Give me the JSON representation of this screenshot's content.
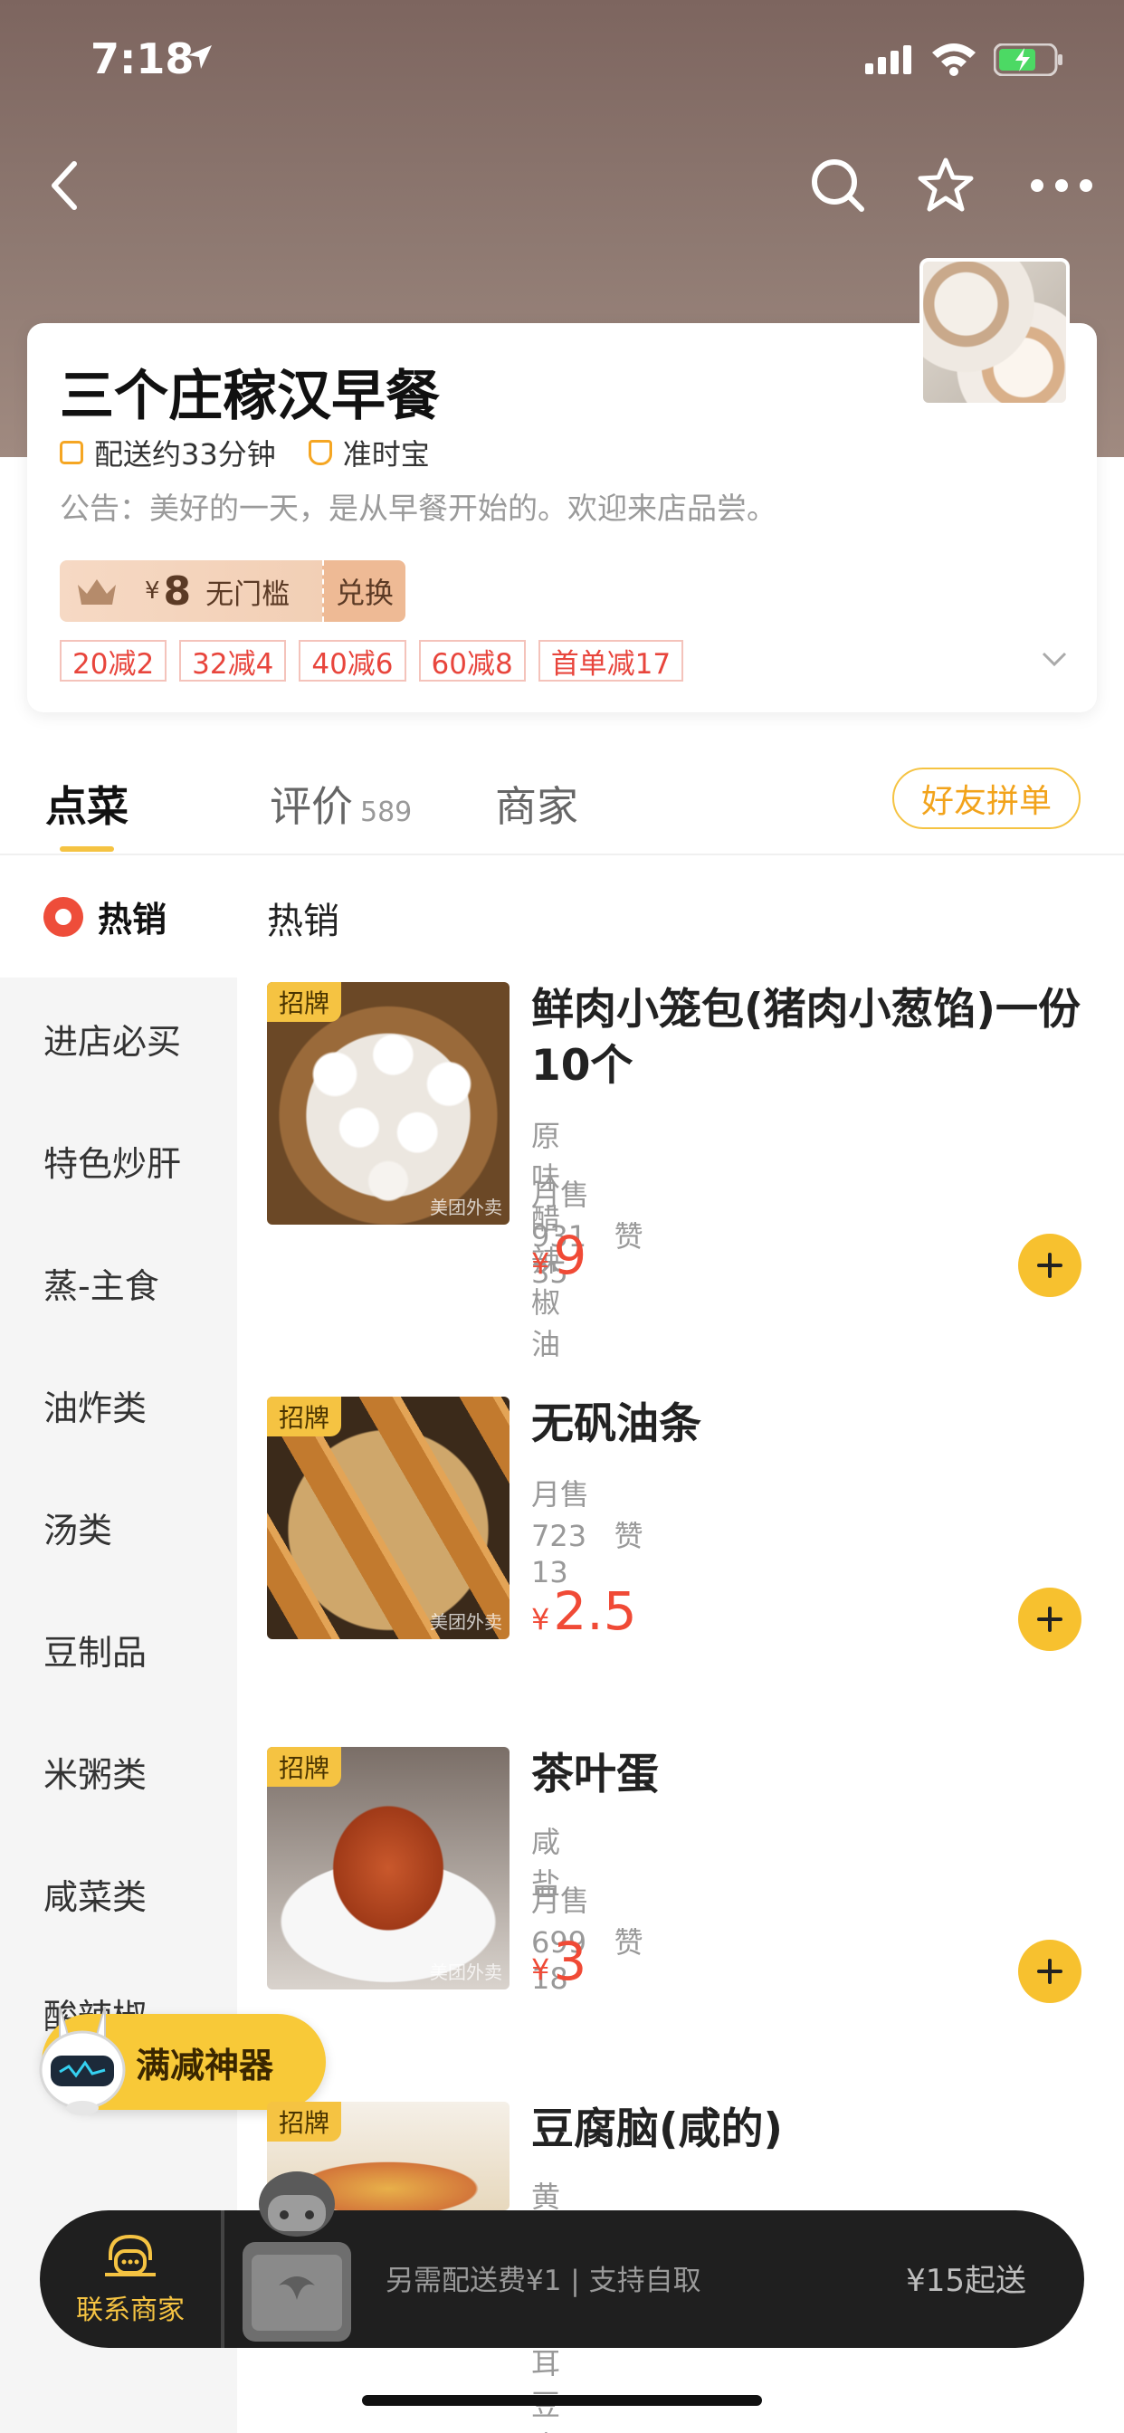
{
  "status_bar": {
    "time": "7:18"
  },
  "nav": {
    "back_icon": "back-icon",
    "search_icon": "search-icon",
    "favorite_icon": "star-icon",
    "more_icon": "more-icon"
  },
  "store": {
    "name": "三个庄稼汉早餐",
    "delivery_time": "配送约33分钟",
    "guarantee": "准时宝",
    "notice": "公告：美好的一天，是从早餐开始的。欢迎来店品尝。",
    "coupon": {
      "currency": "¥",
      "amount": "8",
      "condition": "无门槛",
      "action": "兑换"
    },
    "discounts": [
      "20减2",
      "32减4",
      "40减6",
      "60减8",
      "首单减17"
    ]
  },
  "tabs": [
    {
      "label": "点菜"
    },
    {
      "label": "评价",
      "count": "589"
    },
    {
      "label": "商家"
    }
  ],
  "group_order_button": "好友拼单",
  "sidebar": {
    "active": "热销",
    "items": [
      "进店必买",
      "特色炒肝",
      "蒸-主食",
      "油炸类",
      "汤类",
      "豆制品",
      "米粥类",
      "咸菜类",
      "酸辣椒"
    ]
  },
  "section_title": "热销",
  "foods": [
    {
      "badge": "招牌",
      "name": "鲜肉小笼包(猪肉小葱馅)一份10个",
      "desc": "原味 醋 辣椒油",
      "sales": "月售931",
      "likes": "赞35",
      "currency": "¥",
      "price": "9",
      "watermark": "美团外卖"
    },
    {
      "badge": "招牌",
      "name": "无矾油条",
      "desc": "",
      "sales": "月售723",
      "likes": "赞13",
      "currency": "¥",
      "price": "2.5",
      "watermark": "美团外卖"
    },
    {
      "badge": "招牌",
      "name": "茶叶蛋",
      "desc": "咸 盐",
      "sales": "月售699",
      "likes": "赞18",
      "currency": "¥",
      "price": "3",
      "watermark": "美团外卖"
    },
    {
      "badge": "招牌",
      "name": "豆腐脑(咸的)",
      "desc": "黄豆 黑木耳 豆腐皮",
      "sales": "",
      "likes": "",
      "currency": "¥",
      "price": "",
      "watermark": ""
    }
  ],
  "promo_tool": "满减神器",
  "cart": {
    "contact_label": "联系商家",
    "info": "另需配送费¥1 | 支持自取",
    "min_order": "¥15起送"
  },
  "colors": {
    "accent": "#f5c342",
    "price": "#f04a36",
    "discount_border": "#f4c3bb",
    "cart_bg": "#1f1f1f"
  }
}
